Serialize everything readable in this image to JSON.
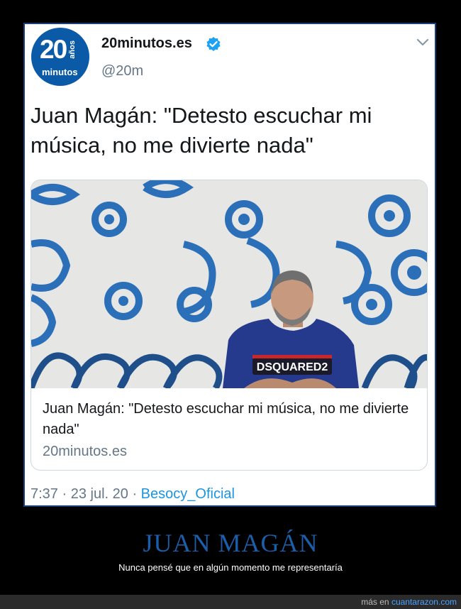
{
  "tweet": {
    "avatar": {
      "number": "20",
      "years": "años",
      "word": "minutos"
    },
    "account_name": "20minutos.es",
    "handle": "@20m",
    "text": "Juan Magán: \"Detesto escuchar mi música, no me divierte nada\"",
    "link_preview": {
      "title": "Juan Magán: \"Detesto escuchar mi música, no me divierte nada\"",
      "domain": "20minutos.es",
      "shirt_text": "DSQUARED2"
    },
    "time": "7:37",
    "date": "23 jul. 20",
    "separator": " · ",
    "source": "Besocy_Oficial"
  },
  "post": {
    "title": "JUAN MAGÁN",
    "subtitle": "Nunca pensé que en algún momento me representaría"
  },
  "footer": {
    "prefix": "más en",
    "site": "cuantarazon.com"
  },
  "colors": {
    "brand_blue": "#0a5aa8",
    "verified": "#1da1f2",
    "link_blue": "#1b95e0",
    "tile_blue": "#2a6fb8",
    "title_blue": "#1b5ea9"
  }
}
